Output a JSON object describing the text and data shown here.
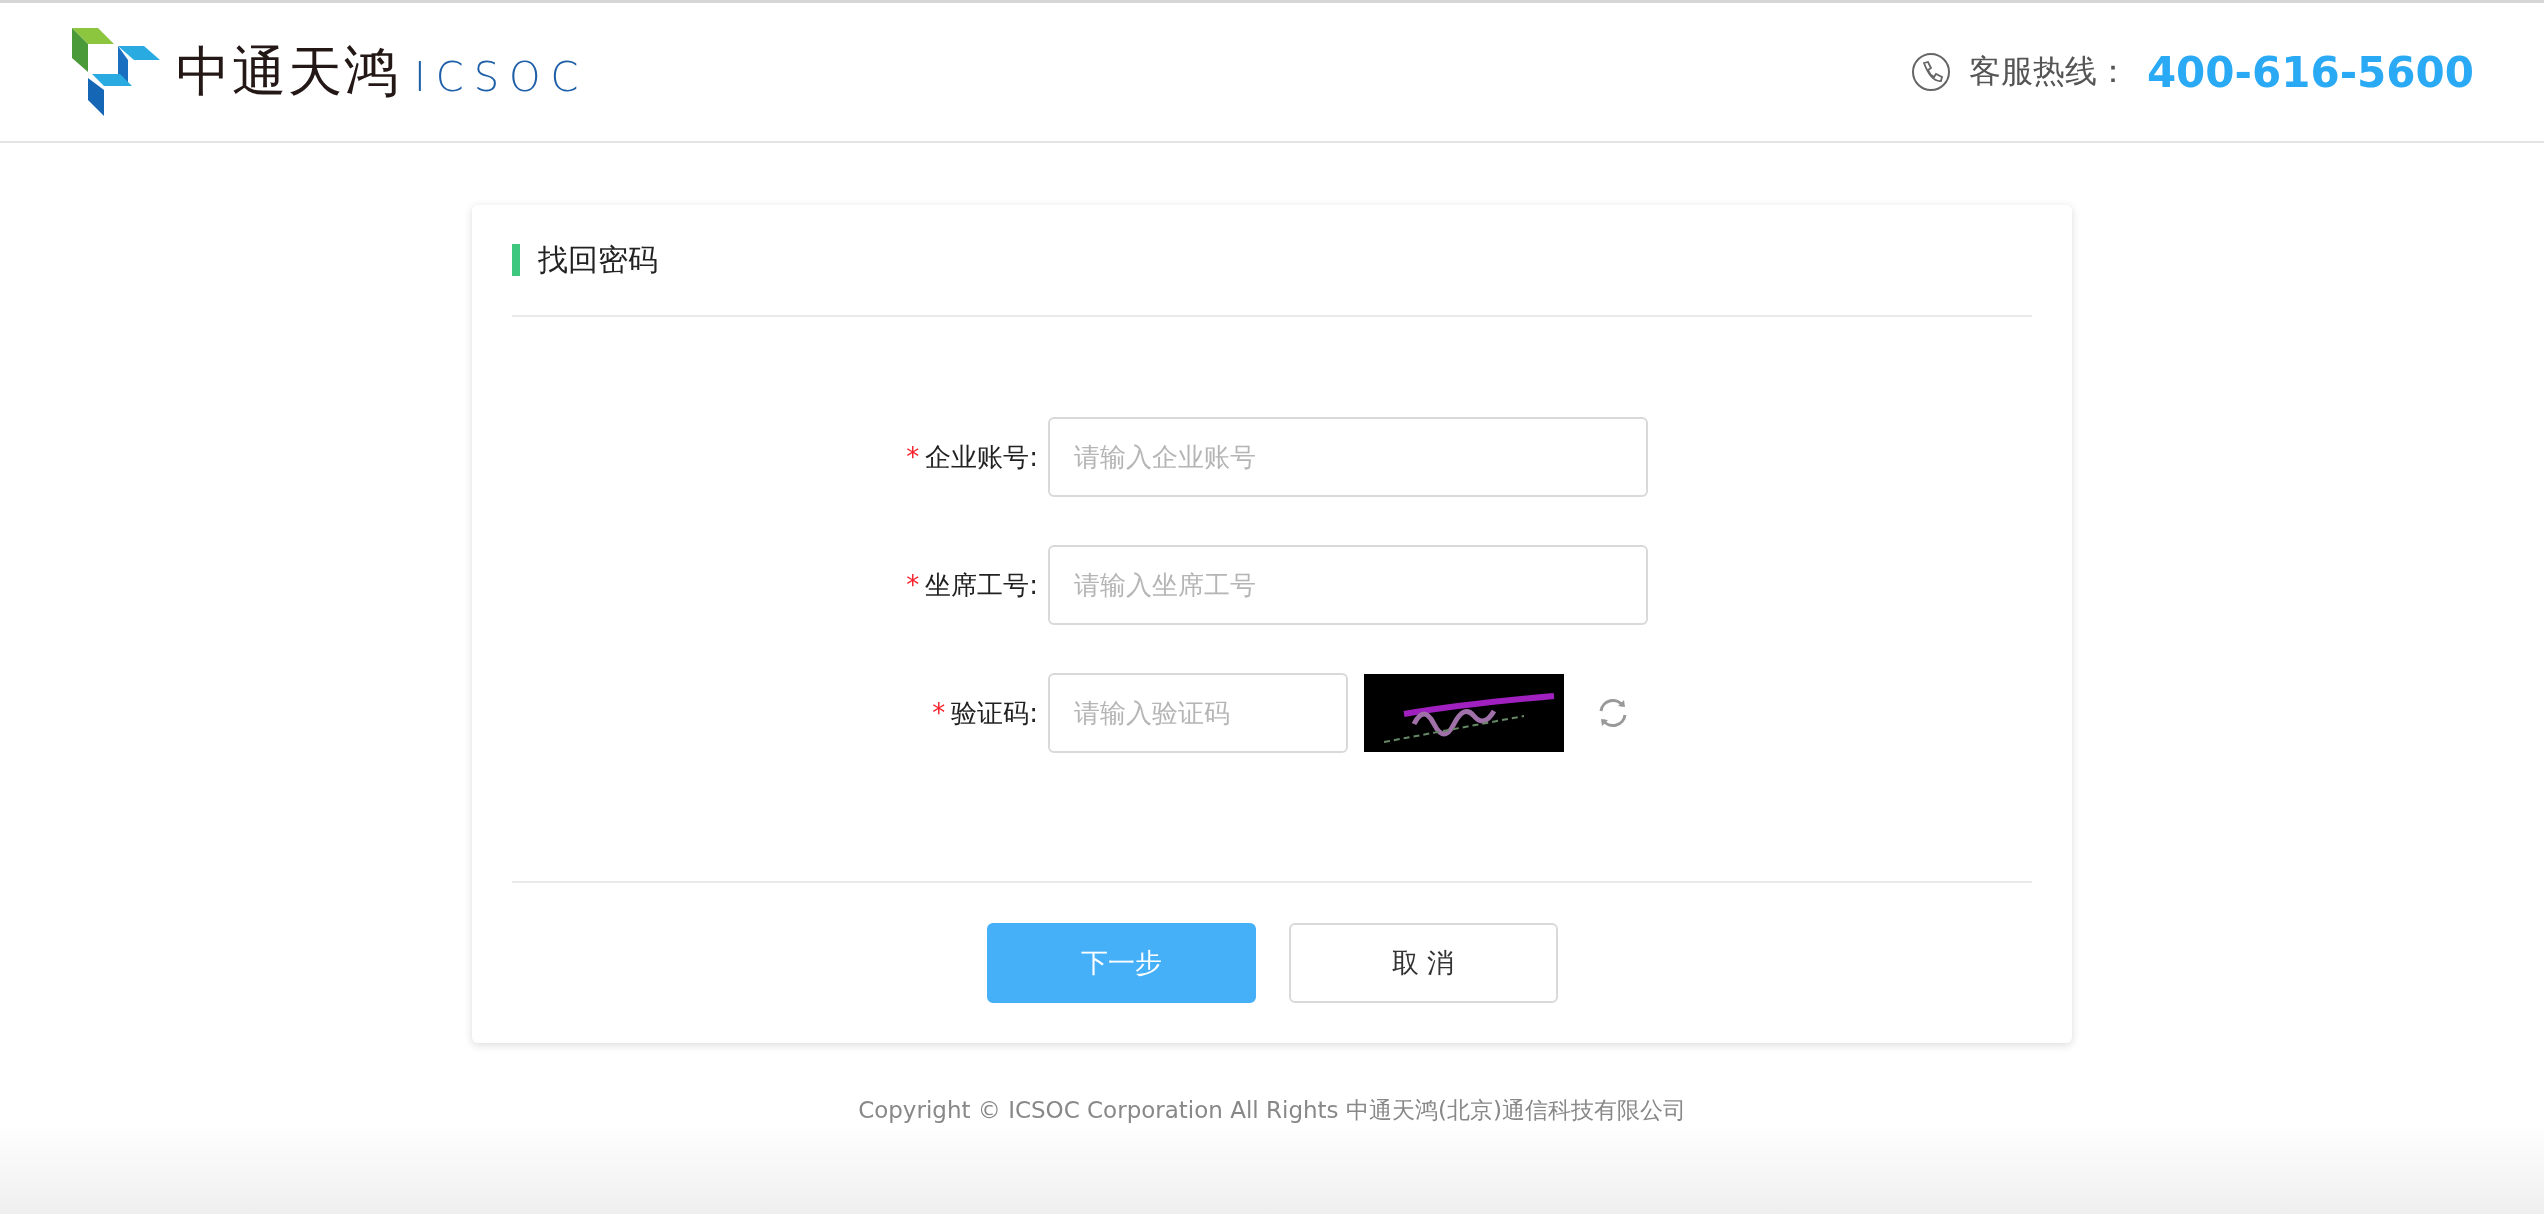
{
  "header": {
    "logo": {
      "name": "中通天鸿",
      "latin": "ICSOC"
    },
    "hotline": {
      "label": "客服热线：",
      "number": "400-616-5600"
    }
  },
  "card": {
    "title": "找回密码",
    "fields": [
      {
        "kind": "text",
        "required_mark": "*",
        "label": "企业账号:",
        "placeholder": "请输入企业账号"
      },
      {
        "kind": "text",
        "required_mark": "*",
        "label": "坐席工号:",
        "placeholder": "请输入坐席工号"
      },
      {
        "kind": "captcha",
        "required_mark": "*",
        "label": "验证码:",
        "placeholder": "请输入验证码"
      }
    ],
    "buttons": [
      {
        "kind": "primary",
        "label": "下一步"
      },
      {
        "kind": "secondary",
        "label": "取 消"
      }
    ]
  },
  "footer": {
    "copyright": "Copyright © ICSOC Corporation All Rights 中通天鸿(北京)通信科技有限公司"
  }
}
